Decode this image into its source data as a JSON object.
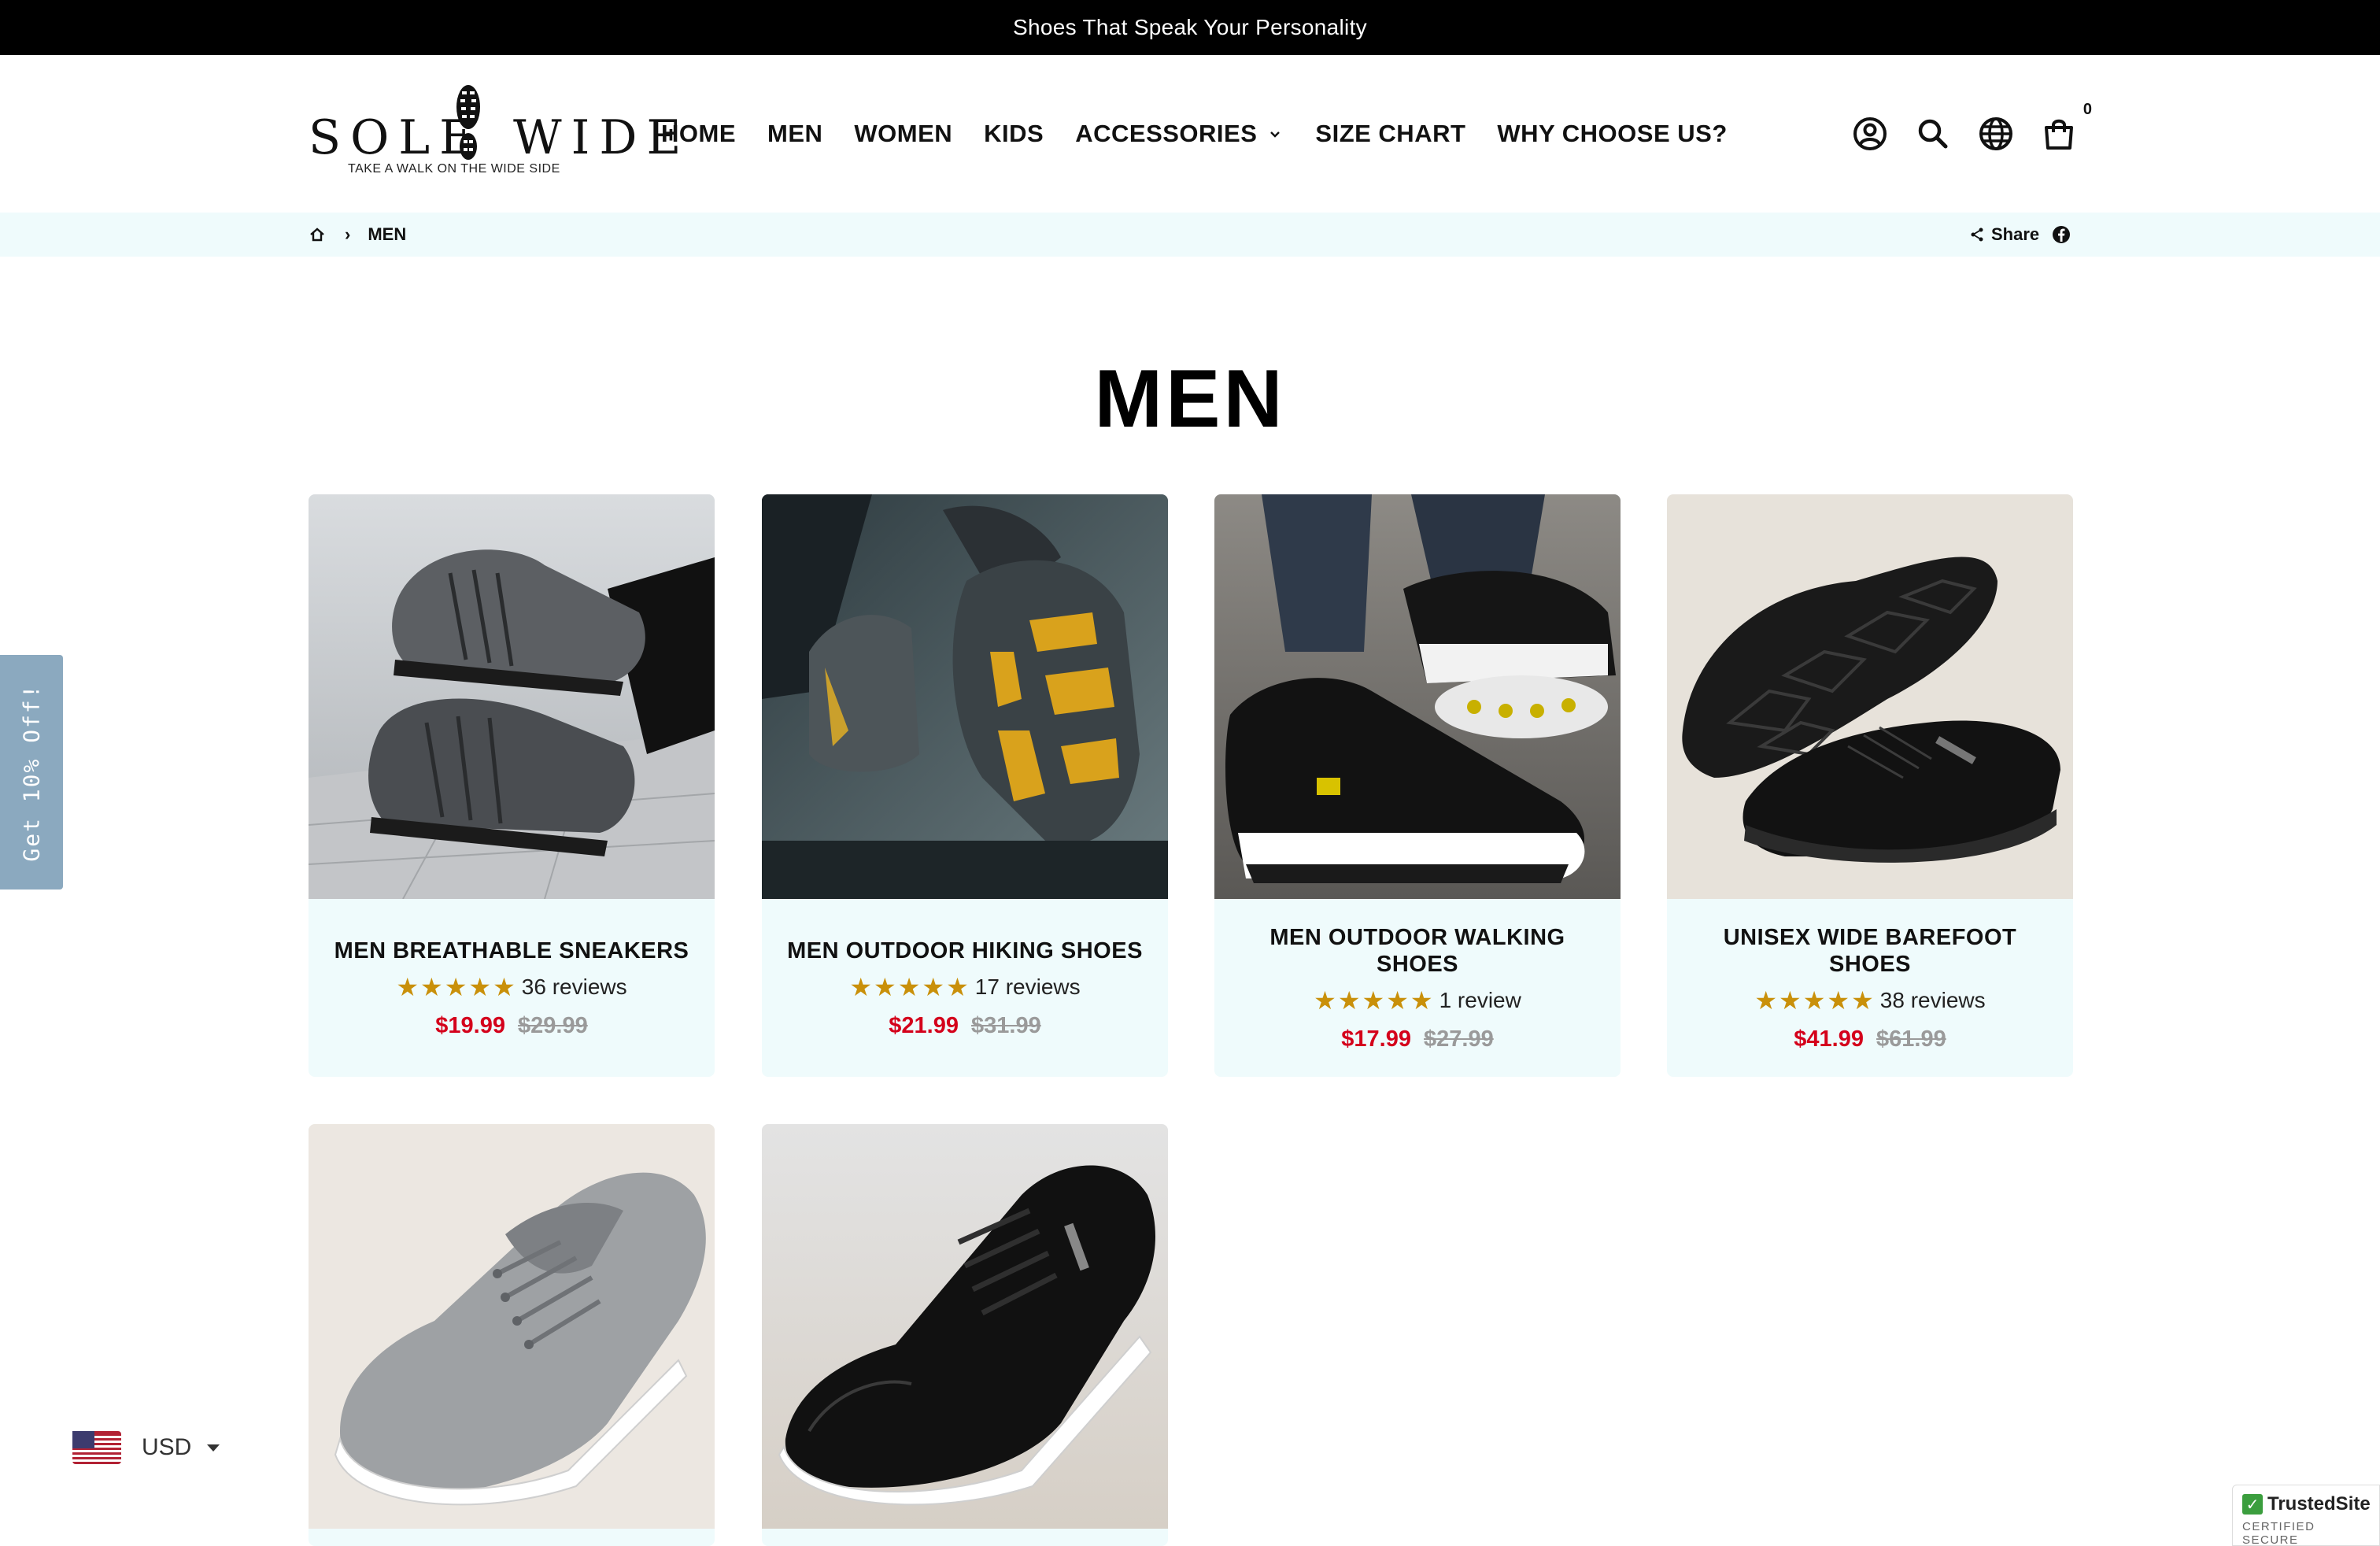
{
  "announcement": "Shoes That Speak Your Personality",
  "logo": {
    "left_word": "SOLE",
    "right_word": "WIDE",
    "tagline": "TAKE A WALK ON  THE WIDE SIDE"
  },
  "nav": {
    "items": [
      "HOME",
      "MEN",
      "WOMEN",
      "KIDS",
      "ACCESSORIES",
      "SIZE CHART",
      "WHY CHOOSE US?"
    ]
  },
  "header_icons": [
    "account-icon",
    "search-icon",
    "globe-icon",
    "cart-icon"
  ],
  "cart_count": "0",
  "breadcrumb": {
    "current": "MEN",
    "share_label": "Share"
  },
  "page_title": "MEN",
  "products": [
    {
      "name": "MEN BREATHABLE SNEAKERS",
      "rating": 5,
      "reviews": "36 reviews",
      "price": "$19.99",
      "compare_price": "$29.99"
    },
    {
      "name": "MEN OUTDOOR HIKING SHOES",
      "rating": 5,
      "reviews": "17 reviews",
      "price": "$21.99",
      "compare_price": "$31.99"
    },
    {
      "name": "MEN OUTDOOR WALKING SHOES",
      "rating": 5,
      "reviews": "1 review",
      "price": "$17.99",
      "compare_price": "$27.99"
    },
    {
      "name": "UNISEX WIDE BAREFOOT SHOES",
      "rating": 5,
      "reviews": "38 reviews",
      "price": "$41.99",
      "compare_price": "$61.99"
    }
  ],
  "stars_glyph": "★★★★★",
  "side_tab": "Get 10% Off!",
  "currency": {
    "code": "USD"
  },
  "trusted": {
    "title": "TrustedSite",
    "subtitle": "CERTIFIED SECURE"
  },
  "colors": {
    "accent_sale": "#d4001b",
    "star": "#c9900a",
    "card_bg": "#effbfc",
    "side_tab": "#8ba9bf"
  }
}
